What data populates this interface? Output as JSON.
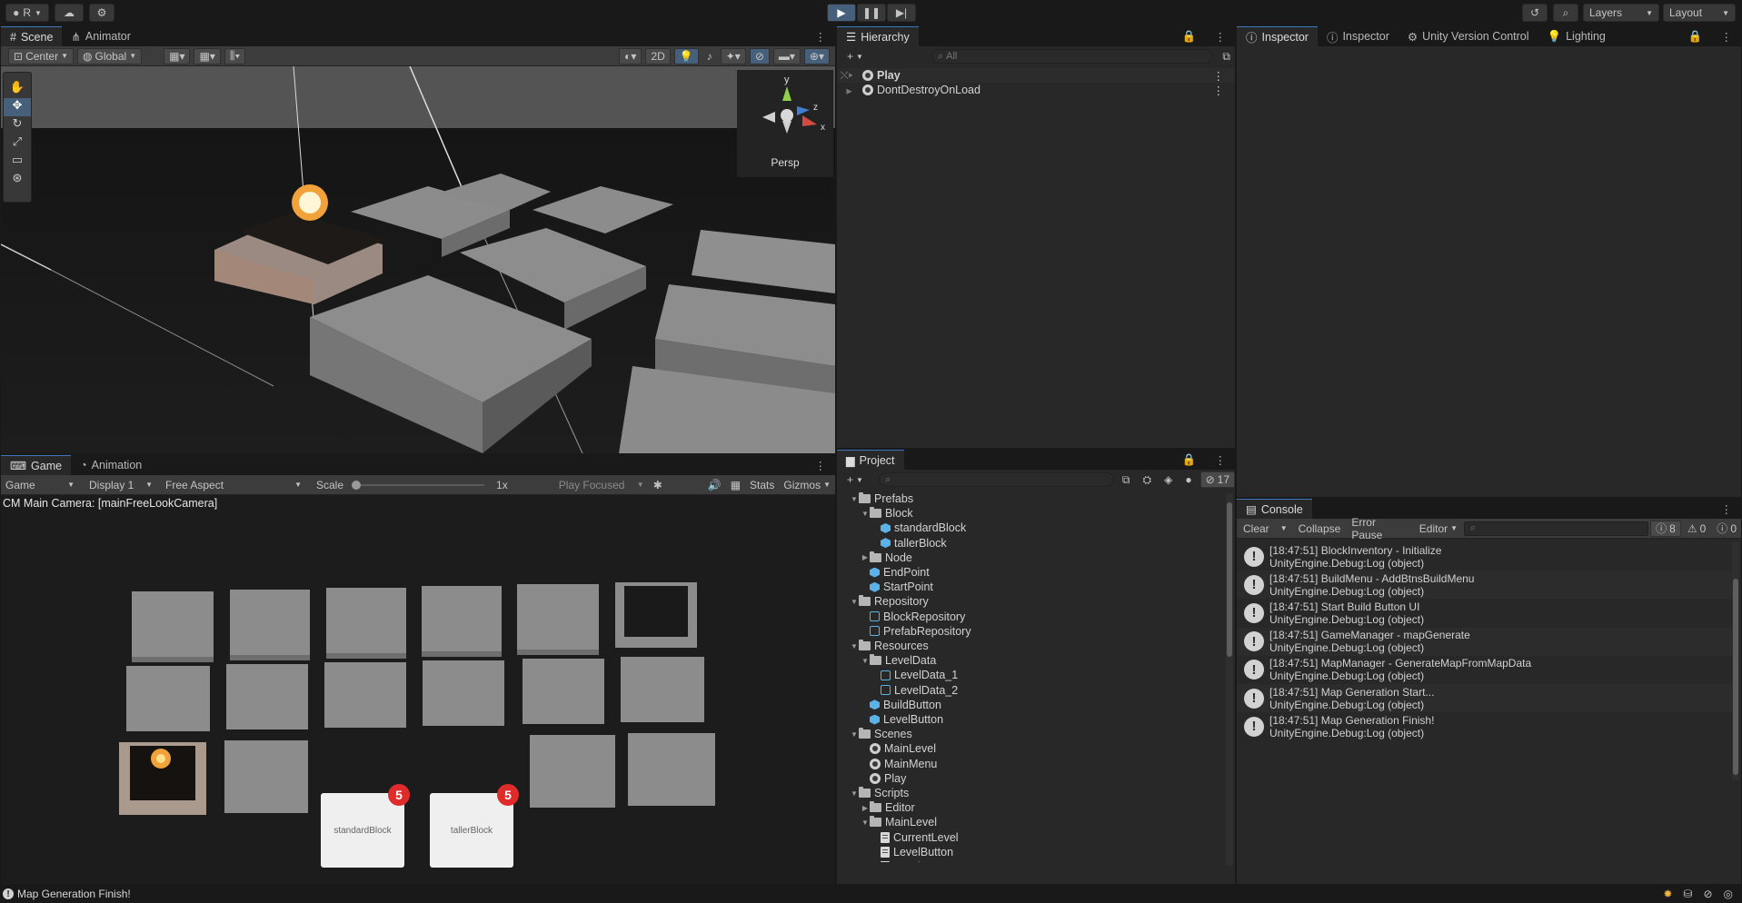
{
  "toolbar": {
    "account": "R",
    "layers": "Layers",
    "layout": "Layout"
  },
  "scene_panel": {
    "tabs": [
      "Scene",
      "Animator"
    ],
    "pivot": "Center",
    "space": "Global",
    "mode_2d": "2D",
    "persp": "Persp"
  },
  "game_panel": {
    "tabs": [
      "Game",
      "Animation"
    ],
    "view_select": "Game",
    "display": "Display 1",
    "aspect": "Free Aspect",
    "scale_label": "Scale",
    "scale_value": "1x",
    "play_focused": "Play Focused",
    "stats": "Stats",
    "gizmos": "Gizmos",
    "camera_label": "CM Main Camera: [mainFreeLookCamera]",
    "cards": [
      {
        "label": "standardBlock",
        "count": "5"
      },
      {
        "label": "tallerBlock",
        "count": "5"
      }
    ]
  },
  "hierarchy": {
    "title": "Hierarchy",
    "search_placeholder": "All",
    "items": [
      {
        "label": "Play"
      },
      {
        "label": "DontDestroyOnLoad"
      }
    ]
  },
  "project": {
    "title": "Project",
    "badge": "17",
    "tree": [
      {
        "label": "Prefabs",
        "depth": 0,
        "icon": "folder",
        "expanded": true
      },
      {
        "label": "Block",
        "depth": 1,
        "icon": "folder",
        "expanded": true
      },
      {
        "label": "standardBlock",
        "depth": 2,
        "icon": "prefab"
      },
      {
        "label": "tallerBlock",
        "depth": 2,
        "icon": "prefab"
      },
      {
        "label": "Node",
        "depth": 1,
        "icon": "folder",
        "expanded": false
      },
      {
        "label": "EndPoint",
        "depth": 1,
        "icon": "prefab"
      },
      {
        "label": "StartPoint",
        "depth": 1,
        "icon": "prefab"
      },
      {
        "label": "Repository",
        "depth": 0,
        "icon": "folder",
        "expanded": true
      },
      {
        "label": "BlockRepository",
        "depth": 1,
        "icon": "so"
      },
      {
        "label": "PrefabRepository",
        "depth": 1,
        "icon": "so"
      },
      {
        "label": "Resources",
        "depth": 0,
        "icon": "folder",
        "expanded": true
      },
      {
        "label": "LevelData",
        "depth": 1,
        "icon": "folder",
        "expanded": true
      },
      {
        "label": "LevelData_1",
        "depth": 2,
        "icon": "so"
      },
      {
        "label": "LevelData_2",
        "depth": 2,
        "icon": "so"
      },
      {
        "label": "BuildButton",
        "depth": 1,
        "icon": "prefab"
      },
      {
        "label": "LevelButton",
        "depth": 1,
        "icon": "prefab"
      },
      {
        "label": "Scenes",
        "depth": 0,
        "icon": "folder",
        "expanded": true
      },
      {
        "label": "MainLevel",
        "depth": 1,
        "icon": "scene"
      },
      {
        "label": "MainMenu",
        "depth": 1,
        "icon": "scene"
      },
      {
        "label": "Play",
        "depth": 1,
        "icon": "scene"
      },
      {
        "label": "Scripts",
        "depth": 0,
        "icon": "folder",
        "expanded": true
      },
      {
        "label": "Editor",
        "depth": 1,
        "icon": "folder",
        "expanded": false
      },
      {
        "label": "MainLevel",
        "depth": 1,
        "icon": "folder",
        "expanded": true
      },
      {
        "label": "CurrentLevel",
        "depth": 2,
        "icon": "script"
      },
      {
        "label": "LevelButton",
        "depth": 2,
        "icon": "script"
      },
      {
        "label": "LevelManager",
        "depth": 2,
        "icon": "script"
      }
    ]
  },
  "inspector": {
    "tabs": [
      "Inspector",
      "Inspector",
      "Unity Version Control",
      "Lighting"
    ]
  },
  "console": {
    "title": "Console",
    "clear": "Clear",
    "collapse": "Collapse",
    "error_pause": "Error Pause",
    "editor": "Editor",
    "count_log": "8",
    "count_warn": "0",
    "count_err": "0",
    "logs": [
      {
        "line1": "[18:47:51] BlockInventory - Initialize",
        "line2": "UnityEngine.Debug:Log (object)"
      },
      {
        "line1": "[18:47:51] BuildMenu - AddBtnsBuildMenu",
        "line2": "UnityEngine.Debug:Log (object)"
      },
      {
        "line1": "[18:47:51] Start Build Button UI",
        "line2": "UnityEngine.Debug:Log (object)"
      },
      {
        "line1": "[18:47:51] GameManager - mapGenerate",
        "line2": "UnityEngine.Debug:Log (object)"
      },
      {
        "line1": "[18:47:51] MapManager - GenerateMapFromMapData",
        "line2": "UnityEngine.Debug:Log (object)"
      },
      {
        "line1": "[18:47:51] Map Generation Start...",
        "line2": "UnityEngine.Debug:Log (object)"
      },
      {
        "line1": "[18:47:51] Map Generation Finish!",
        "line2": "UnityEngine.Debug:Log (object)"
      }
    ]
  },
  "status_bar": {
    "message": "Map Generation Finish!"
  }
}
